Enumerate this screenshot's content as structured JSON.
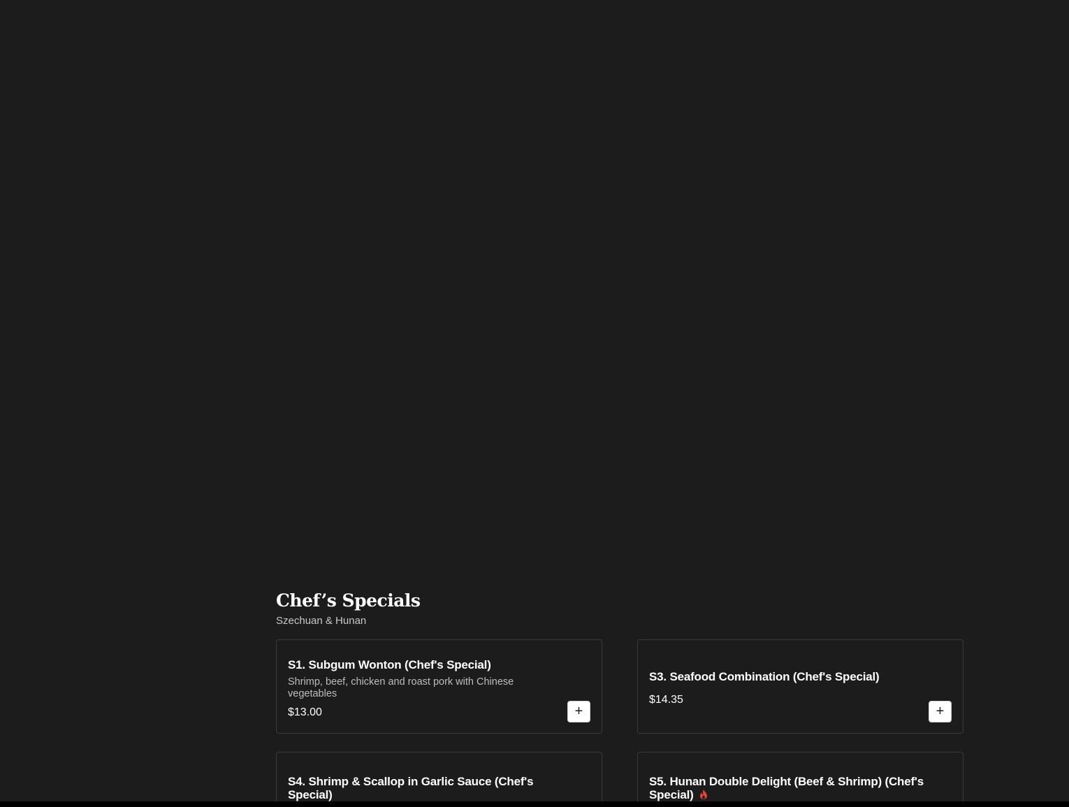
{
  "section": {
    "title": "Chef’s Specials",
    "subtitle": "Szechuan & Hunan"
  },
  "items": [
    {
      "name": "S1. Subgum Wonton (Chef's Special)",
      "description": "Shrimp, beef, chicken and roast pork with Chinese vegetables",
      "price": "$13.00",
      "add_label": "+"
    },
    {
      "name": "S3. Seafood Combination (Chef's Special)",
      "description": "",
      "price": "$14.35",
      "add_label": "+"
    },
    {
      "name": "S4. Shrimp & Scallop in Garlic Sauce (Chef's Special)",
      "spicy": true
    },
    {
      "name": "S5. Hunan Double Delight (Beef & Shrimp) (Chef's Special)",
      "spicy": true
    }
  ],
  "colors": {
    "background": "#1c1c1c",
    "card_border": "#3a3a3a",
    "spicy_icon": "#e0453a"
  }
}
